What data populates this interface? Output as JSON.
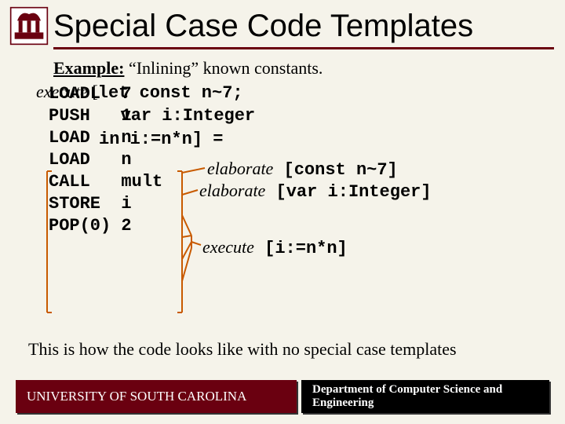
{
  "title": "Special Case Code Templates",
  "example_label": "Example:",
  "example_text": " “Inlining” known constants.",
  "execute_label": "execute",
  "execute_bracket": " [",
  "let_line1": "let const n~7;",
  "let_line2": "    var i:Integer",
  "let_line3": "in i:=n*n]  =",
  "code": [
    "LOADL  7",
    "PUSH   1",
    "LOAD   n",
    "LOAD   n",
    "CALL   mult",
    "STORE  i",
    "POP(0) 2"
  ],
  "anno1_label": "elaborate",
  "anno1_code": " [const n~7]",
  "anno2_label": "elaborate",
  "anno2_code": " [var i:Integer]",
  "anno3_label": "execute",
  "anno3_code": " [i:=n*n]",
  "note": "This is how the code looks like with no special case templates",
  "footer_left": "UNIVERSITY OF SOUTH CAROLINA",
  "footer_right": "Department of Computer Science and Engineering"
}
